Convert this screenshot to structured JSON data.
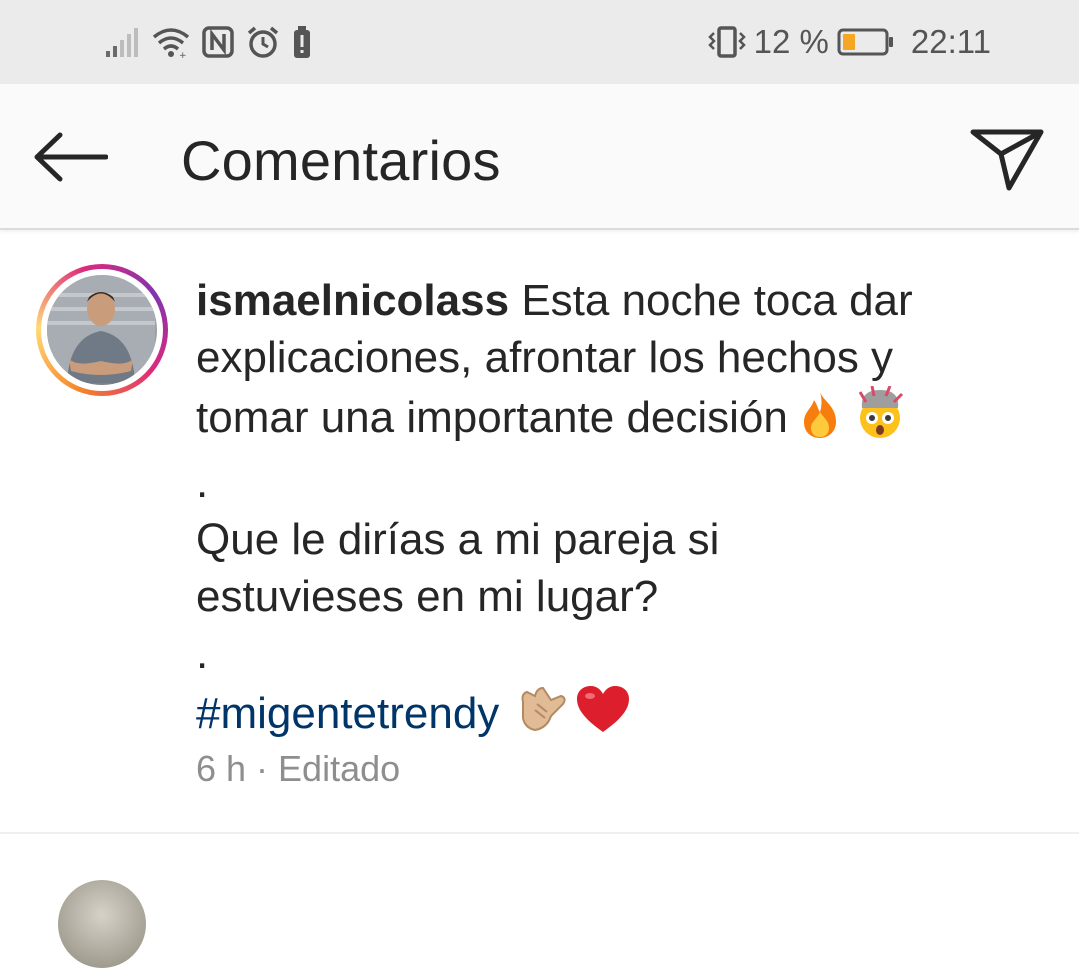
{
  "status_bar": {
    "battery_percent": "12 %",
    "time": "22:11",
    "battery_level": 0.12,
    "battery_color": "#f5a623",
    "icons": [
      "signal-icon",
      "wifi-icon",
      "nfc-icon",
      "alarm-icon",
      "battery-saver-icon",
      "vibrate-icon",
      "battery-icon"
    ]
  },
  "header": {
    "title": "Comentarios",
    "back_icon": "back-arrow-icon",
    "send_icon": "direct-send-icon"
  },
  "caption": {
    "username": "ismaelnicolass",
    "lines": [
      "Esta noche toca dar",
      "explicaciones, afrontar los hechos y",
      "tomar una importante decisión"
    ],
    "dot_1": ".",
    "lines_2": [
      "Que le dirías a mi pareja si",
      "estuvieses en mi lugar?"
    ],
    "dot_2": ".",
    "hashtag": "#migentetrendy",
    "emojis_line3": [
      "fire-emoji",
      "exploding-head-emoji"
    ],
    "emojis_hashtag": [
      "call-me-hand-emoji",
      "red-heart-emoji"
    ],
    "meta": "6 h · Editado"
  },
  "colors": {
    "hashtag": "#003569",
    "meta_text": "#8e8e8e",
    "status_bar_bg": "#ebebeb",
    "header_bg": "#fafafa"
  }
}
